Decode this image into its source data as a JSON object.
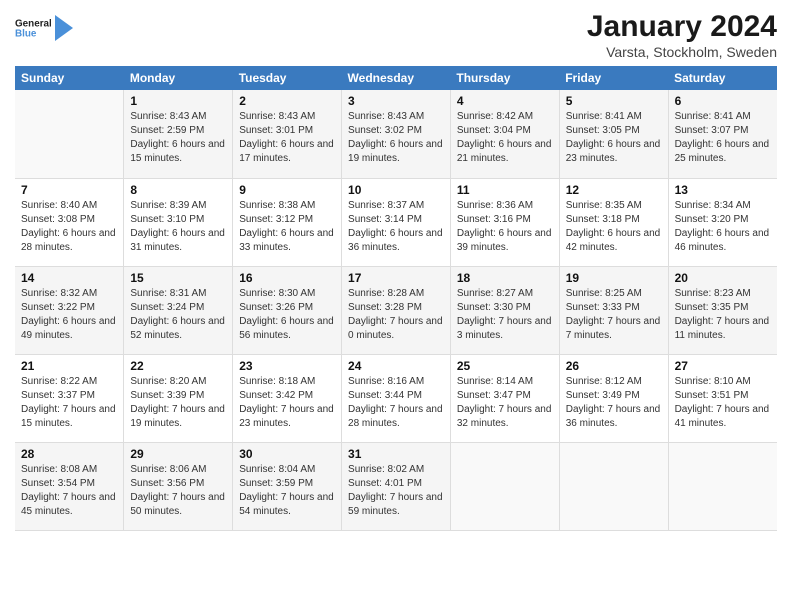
{
  "logo": {
    "line1": "General",
    "line2": "Blue"
  },
  "title": "January 2024",
  "location": "Varsta, Stockholm, Sweden",
  "weekdays": [
    "Sunday",
    "Monday",
    "Tuesday",
    "Wednesday",
    "Thursday",
    "Friday",
    "Saturday"
  ],
  "weeks": [
    [
      {
        "day": "",
        "sunrise": "",
        "sunset": "",
        "daylight": ""
      },
      {
        "day": "1",
        "sunrise": "Sunrise: 8:43 AM",
        "sunset": "Sunset: 2:59 PM",
        "daylight": "Daylight: 6 hours and 15 minutes."
      },
      {
        "day": "2",
        "sunrise": "Sunrise: 8:43 AM",
        "sunset": "Sunset: 3:01 PM",
        "daylight": "Daylight: 6 hours and 17 minutes."
      },
      {
        "day": "3",
        "sunrise": "Sunrise: 8:43 AM",
        "sunset": "Sunset: 3:02 PM",
        "daylight": "Daylight: 6 hours and 19 minutes."
      },
      {
        "day": "4",
        "sunrise": "Sunrise: 8:42 AM",
        "sunset": "Sunset: 3:04 PM",
        "daylight": "Daylight: 6 hours and 21 minutes."
      },
      {
        "day": "5",
        "sunrise": "Sunrise: 8:41 AM",
        "sunset": "Sunset: 3:05 PM",
        "daylight": "Daylight: 6 hours and 23 minutes."
      },
      {
        "day": "6",
        "sunrise": "Sunrise: 8:41 AM",
        "sunset": "Sunset: 3:07 PM",
        "daylight": "Daylight: 6 hours and 25 minutes."
      }
    ],
    [
      {
        "day": "7",
        "sunrise": "Sunrise: 8:40 AM",
        "sunset": "Sunset: 3:08 PM",
        "daylight": "Daylight: 6 hours and 28 minutes."
      },
      {
        "day": "8",
        "sunrise": "Sunrise: 8:39 AM",
        "sunset": "Sunset: 3:10 PM",
        "daylight": "Daylight: 6 hours and 31 minutes."
      },
      {
        "day": "9",
        "sunrise": "Sunrise: 8:38 AM",
        "sunset": "Sunset: 3:12 PM",
        "daylight": "Daylight: 6 hours and 33 minutes."
      },
      {
        "day": "10",
        "sunrise": "Sunrise: 8:37 AM",
        "sunset": "Sunset: 3:14 PM",
        "daylight": "Daylight: 6 hours and 36 minutes."
      },
      {
        "day": "11",
        "sunrise": "Sunrise: 8:36 AM",
        "sunset": "Sunset: 3:16 PM",
        "daylight": "Daylight: 6 hours and 39 minutes."
      },
      {
        "day": "12",
        "sunrise": "Sunrise: 8:35 AM",
        "sunset": "Sunset: 3:18 PM",
        "daylight": "Daylight: 6 hours and 42 minutes."
      },
      {
        "day": "13",
        "sunrise": "Sunrise: 8:34 AM",
        "sunset": "Sunset: 3:20 PM",
        "daylight": "Daylight: 6 hours and 46 minutes."
      }
    ],
    [
      {
        "day": "14",
        "sunrise": "Sunrise: 8:32 AM",
        "sunset": "Sunset: 3:22 PM",
        "daylight": "Daylight: 6 hours and 49 minutes."
      },
      {
        "day": "15",
        "sunrise": "Sunrise: 8:31 AM",
        "sunset": "Sunset: 3:24 PM",
        "daylight": "Daylight: 6 hours and 52 minutes."
      },
      {
        "day": "16",
        "sunrise": "Sunrise: 8:30 AM",
        "sunset": "Sunset: 3:26 PM",
        "daylight": "Daylight: 6 hours and 56 minutes."
      },
      {
        "day": "17",
        "sunrise": "Sunrise: 8:28 AM",
        "sunset": "Sunset: 3:28 PM",
        "daylight": "Daylight: 7 hours and 0 minutes."
      },
      {
        "day": "18",
        "sunrise": "Sunrise: 8:27 AM",
        "sunset": "Sunset: 3:30 PM",
        "daylight": "Daylight: 7 hours and 3 minutes."
      },
      {
        "day": "19",
        "sunrise": "Sunrise: 8:25 AM",
        "sunset": "Sunset: 3:33 PM",
        "daylight": "Daylight: 7 hours and 7 minutes."
      },
      {
        "day": "20",
        "sunrise": "Sunrise: 8:23 AM",
        "sunset": "Sunset: 3:35 PM",
        "daylight": "Daylight: 7 hours and 11 minutes."
      }
    ],
    [
      {
        "day": "21",
        "sunrise": "Sunrise: 8:22 AM",
        "sunset": "Sunset: 3:37 PM",
        "daylight": "Daylight: 7 hours and 15 minutes."
      },
      {
        "day": "22",
        "sunrise": "Sunrise: 8:20 AM",
        "sunset": "Sunset: 3:39 PM",
        "daylight": "Daylight: 7 hours and 19 minutes."
      },
      {
        "day": "23",
        "sunrise": "Sunrise: 8:18 AM",
        "sunset": "Sunset: 3:42 PM",
        "daylight": "Daylight: 7 hours and 23 minutes."
      },
      {
        "day": "24",
        "sunrise": "Sunrise: 8:16 AM",
        "sunset": "Sunset: 3:44 PM",
        "daylight": "Daylight: 7 hours and 28 minutes."
      },
      {
        "day": "25",
        "sunrise": "Sunrise: 8:14 AM",
        "sunset": "Sunset: 3:47 PM",
        "daylight": "Daylight: 7 hours and 32 minutes."
      },
      {
        "day": "26",
        "sunrise": "Sunrise: 8:12 AM",
        "sunset": "Sunset: 3:49 PM",
        "daylight": "Daylight: 7 hours and 36 minutes."
      },
      {
        "day": "27",
        "sunrise": "Sunrise: 8:10 AM",
        "sunset": "Sunset: 3:51 PM",
        "daylight": "Daylight: 7 hours and 41 minutes."
      }
    ],
    [
      {
        "day": "28",
        "sunrise": "Sunrise: 8:08 AM",
        "sunset": "Sunset: 3:54 PM",
        "daylight": "Daylight: 7 hours and 45 minutes."
      },
      {
        "day": "29",
        "sunrise": "Sunrise: 8:06 AM",
        "sunset": "Sunset: 3:56 PM",
        "daylight": "Daylight: 7 hours and 50 minutes."
      },
      {
        "day": "30",
        "sunrise": "Sunrise: 8:04 AM",
        "sunset": "Sunset: 3:59 PM",
        "daylight": "Daylight: 7 hours and 54 minutes."
      },
      {
        "day": "31",
        "sunrise": "Sunrise: 8:02 AM",
        "sunset": "Sunset: 4:01 PM",
        "daylight": "Daylight: 7 hours and 59 minutes."
      },
      {
        "day": "",
        "sunrise": "",
        "sunset": "",
        "daylight": ""
      },
      {
        "day": "",
        "sunrise": "",
        "sunset": "",
        "daylight": ""
      },
      {
        "day": "",
        "sunrise": "",
        "sunset": "",
        "daylight": ""
      }
    ]
  ]
}
